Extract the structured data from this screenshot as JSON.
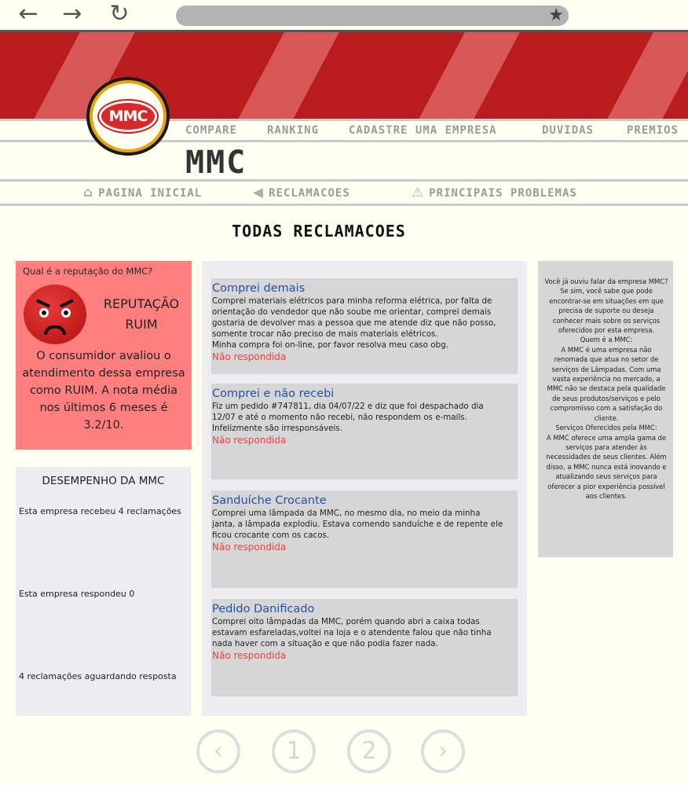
{
  "browser": {
    "back_glyph": "←",
    "forward_glyph": "→",
    "reload_glyph": "↻",
    "bookmark_glyph": "★"
  },
  "logo": {
    "text": "MMC"
  },
  "nav": [
    "COMPARE",
    "RANKING",
    "CADASTRE UMA EMPRESA",
    "DUVIDAS",
    "PREMIOS"
  ],
  "company": {
    "name": "MMC"
  },
  "subnav": [
    {
      "label": "PAGINA INICIAL",
      "icon": "home-icon"
    },
    {
      "label": "RECLAMACOES",
      "icon": "megaphone-icon"
    },
    {
      "label": "PRINCIPAIS PROBLEMAS",
      "icon": "warning-icon"
    }
  ],
  "section_title": "TODAS RECLAMACOES",
  "reputation": {
    "question": "Qual é a reputação do MMC?",
    "icon": "angry-face-icon",
    "title_line1": "REPUTAÇÃO",
    "title_line2": "RUIM",
    "text": "O consumidor avaliou o atendimento dessa empresa como RUIM. A nota média nos últimos 6 meses é 3.2/10."
  },
  "performance": {
    "title": "DESEMPENHO DA MMC",
    "received": "Esta empresa recebeu 4 reclamações",
    "answered": "Esta empresa respondeu 0",
    "waiting": "4 reclamações aguardando resposta"
  },
  "complaints": [
    {
      "title": "Comprei demais",
      "body": "Comprei materiais elétricos para minha reforma elétrica, por falta de orientação do vendedor que não soube me orientar, comprei demais gostaria de devolver mas a pessoa que me atende diz que não posso, somente trocar não preciso de mais materiais elétricos.",
      "body2": "Minha compra foi on-line, por favor resolva meu caso obg.",
      "status": "Não respondida"
    },
    {
      "title": "Comprei e não recebi",
      "body": "Fiz um pedido #747811, dia 04/07/22 e diz que foi despachado dia 12/07 e até o momento não recebi, não respondem os e-mails. Infelizmente são irresponsáveis.",
      "body2": "",
      "status": "Não respondida"
    },
    {
      "title": "Sanduíche Crocante",
      "body": "Comprei uma lâmpada da MMC, no mesmo dia, no meio da minha janta, a lâmpada explodiu. Estava comendo sanduíche e de repente ele ficou crocante com os cacos.",
      "body2": "",
      "status": "Não respondida"
    },
    {
      "title": "Pedido Danificado",
      "body": "Comprei oito lâmpadas da MMC, porém quando abri a caixa todas estavam esfareladas,voltei na loja e o atendente falou que não tinha nada haver com a situação e que não podia fazer nada.",
      "body2": "",
      "status": "Não respondida"
    }
  ],
  "about": {
    "p1": "Você já ouviu falar da empresa MMC? Se sim, você sabe que pode encontrar-se em situações em que precisa de suporte ou deseja conhecer mais sobre os serviços oferecidos por esta empresa.",
    "h2": "Quem é a MMC:",
    "p2": "A MMC é uma empresa não renomada que atua no setor de serviços de Lâmpadas. Com uma vasta experiência no mercado, a MMC não se destaca pela qualidade de seus produtos/serviços e pelo compromisso com a satisfação do cliente.",
    "h3": "Serviços Oferecidos pela MMC:",
    "p3": "A MMC oferece uma ampla gama de serviços para atender às necessidades de seus clientes. Além disso, a MMC nunca está inovando e atualizando seus serviços para oferecer a pior experiência possível aos clientes."
  },
  "pagination": {
    "prev": "‹",
    "page1": "1",
    "page2": "2",
    "next": "›"
  }
}
